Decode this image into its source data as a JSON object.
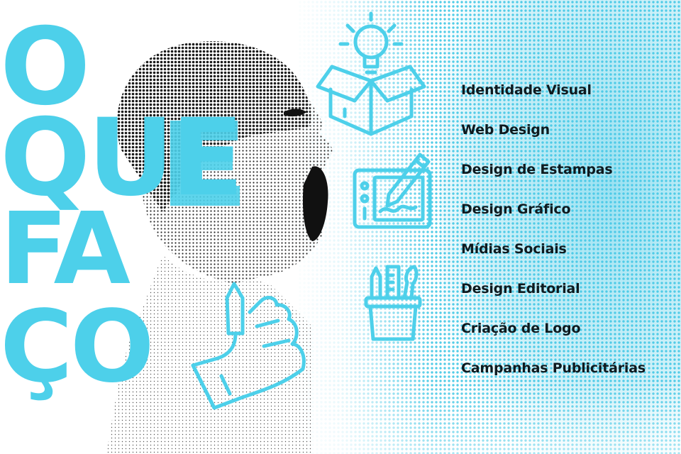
{
  "headline": {
    "line1": "O",
    "line2": "QUE",
    "line3": "FA",
    "line3b": "ÇO"
  },
  "colors": {
    "accent": "#4dd0ea",
    "halftone": "#49c9e6",
    "text": "#0e1a1f",
    "ink": "#1a1a1a"
  },
  "icons": [
    "lightbulb-box-icon",
    "drawing-tablet-icon",
    "pen-cup-icon",
    "hand-holding-pen-icon"
  ],
  "services": [
    "Identidade Visual",
    "Web Design",
    "Design de Estampas",
    "Design Gráfico",
    "Mídias Sociais",
    "Design Editorial",
    "Criação de Logo",
    "Campanhas Publicitárias"
  ]
}
